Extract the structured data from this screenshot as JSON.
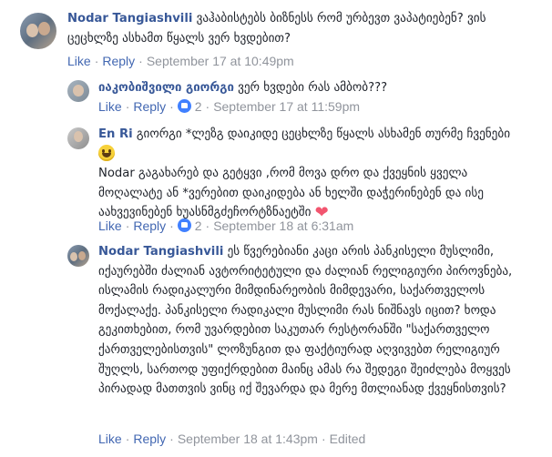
{
  "comments": [
    {
      "author": "Nodar Tangiashvili",
      "text": "ვაჰაბისტებს ბიზნესს რომ ურბევთ ვაპატიებენ? ვის ცეცხლზე ასხამთ წყალს ვერ ხვდებით?",
      "like": "Like",
      "reply": "Reply",
      "timestamp": "September 17 at 10:49pm"
    },
    {
      "author": "იაკობიშვილი გიორგი",
      "text": "ვერ ხვდები რას ამბობ???",
      "like": "Like",
      "reply": "Reply",
      "reaction_count": "2",
      "timestamp": "September 17 at 11:59pm"
    },
    {
      "author": "En Ri",
      "line1": "გიორგი *ლეზგ დაიკიდე ცეცხლზე წყალს ასხამენ თურმე ჩვენები",
      "line2": "Nodar გაგახარებ და გეტყვი ,რომ მოვა დრო და ქვეყნის ყველა მოღალატე ან *ვერებით დაიკიდება ან ხელში დაჭერინებენ და ისე აახვევინებენ ხუასნმგძეჩორტზნაეტში",
      "like": "Like",
      "reply": "Reply",
      "reaction_count": "2",
      "timestamp": "September 18 at 6:31am"
    },
    {
      "author": "Nodar Tangiashvili",
      "text": "ეს წვერებიანი კაცი არის პანკისელი მუსლიმი, იქაურებში ძალიან ავტორიტეტული და ძალიან რელიგიური პიროვნება, ისლამის რადიკალური მიმდინარეობის მიმდევარი, საქართველოს მოქალაქე. პანკისელი რადიკალი მუსლიმი რას ნიშნავს იცით? ხოდა გეკითხებით, რომ უვარდებით საკუთარ რესტორანში \"საქართველო ქართველებისთვის\" ლოზუნგით და ფაქტიურად აღვივებთ რელიგიურ შუღლს, სართოდ უფიქრდებით მაინც ამას რა შედეგი შეიძლება მოყვეს პირადად მათთვის ვინც იქ შევარდა და მერე მთლიანად ქვეყნისთვის?",
      "like": "Like",
      "reply": "Reply",
      "timestamp": "September 18 at 1:43pm",
      "edited": "Edited"
    }
  ],
  "separator": "·",
  "colors": {
    "author": "#385898",
    "action": "#4267b2",
    "meta": "#90949c",
    "like_reaction": "#4080ff",
    "heart": "#f2556f"
  },
  "icons": [
    "like-reaction-icon",
    "smile-emoji-icon",
    "heart-emoji-icon"
  ]
}
